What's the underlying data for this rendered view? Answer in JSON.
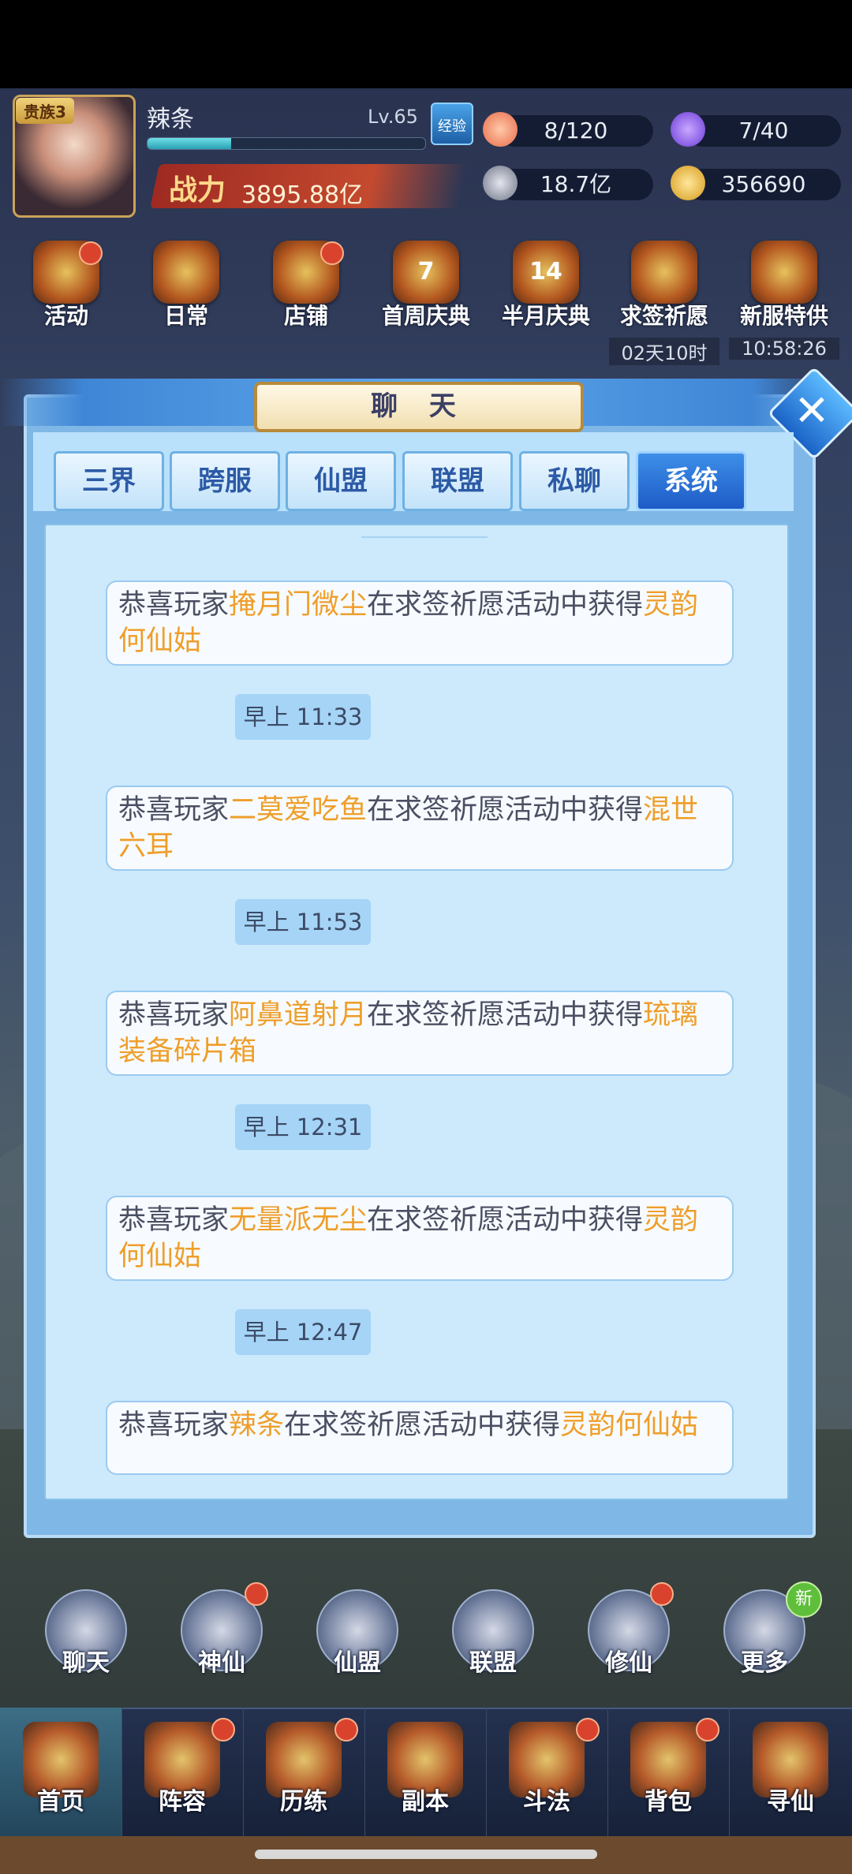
{
  "hud": {
    "rank_badge": "贵族3",
    "player_name": "辣条",
    "level": "Lv.65",
    "exp_button": "经验",
    "exp_fraction": 0.3,
    "power_label": "战力",
    "power_value": "3895.88亿",
    "resources": [
      "8/120",
      "7/40",
      "18.7亿",
      "356690"
    ]
  },
  "features": [
    {
      "label": "活动"
    },
    {
      "label": "日常"
    },
    {
      "label": "店铺"
    },
    {
      "label": "首周庆典",
      "badge": "7"
    },
    {
      "label": "半月庆典",
      "badge": "14"
    },
    {
      "label": "求签祈愿",
      "timer": "02天10时"
    },
    {
      "label": "新服特供",
      "timer": "10:58:26"
    }
  ],
  "chat": {
    "title": "聊 天",
    "tabs": [
      "三界",
      "跨服",
      "仙盟",
      "联盟",
      "私聊",
      "系统"
    ],
    "active_tab": "系统",
    "messages": [
      {
        "prefix": "恭喜玩家",
        "player": "掩月门微尘",
        "middle": "在求签祈愿活动中获得",
        "item": "灵韵何仙姑"
      },
      {
        "time": "早上  11:33"
      },
      {
        "prefix": "恭喜玩家",
        "player": "二莫爱吃鱼",
        "middle": "在求签祈愿活动中获得",
        "item": "混世六耳"
      },
      {
        "time": "早上  11:53"
      },
      {
        "prefix": "恭喜玩家",
        "player": "阿鼻道射月",
        "middle": "在求签祈愿活动中获得",
        "item": "琉璃装备碎片箱"
      },
      {
        "time": "早上  12:31"
      },
      {
        "prefix": "恭喜玩家",
        "player": "无量派无尘",
        "middle": "在求签祈愿活动中获得",
        "item": "灵韵何仙姑"
      },
      {
        "time": "早上  12:47"
      },
      {
        "prefix": "恭喜玩家",
        "player": "辣条",
        "middle": "在求签祈愿活动中获得",
        "item": "灵韵何仙姑"
      }
    ]
  },
  "mid_icons": [
    "聊天",
    "神仙",
    "仙盟",
    "联盟",
    "修仙",
    "更多"
  ],
  "new_badge": "新",
  "bottom_nav": [
    "首页",
    "阵容",
    "历练",
    "副本",
    "斗法",
    "背包",
    "寻仙"
  ],
  "active_nav": "首页",
  "colors": {
    "highlight": "#ef9e2a",
    "tab_active": "#1e5bc7",
    "panel": "#cde9fc"
  }
}
